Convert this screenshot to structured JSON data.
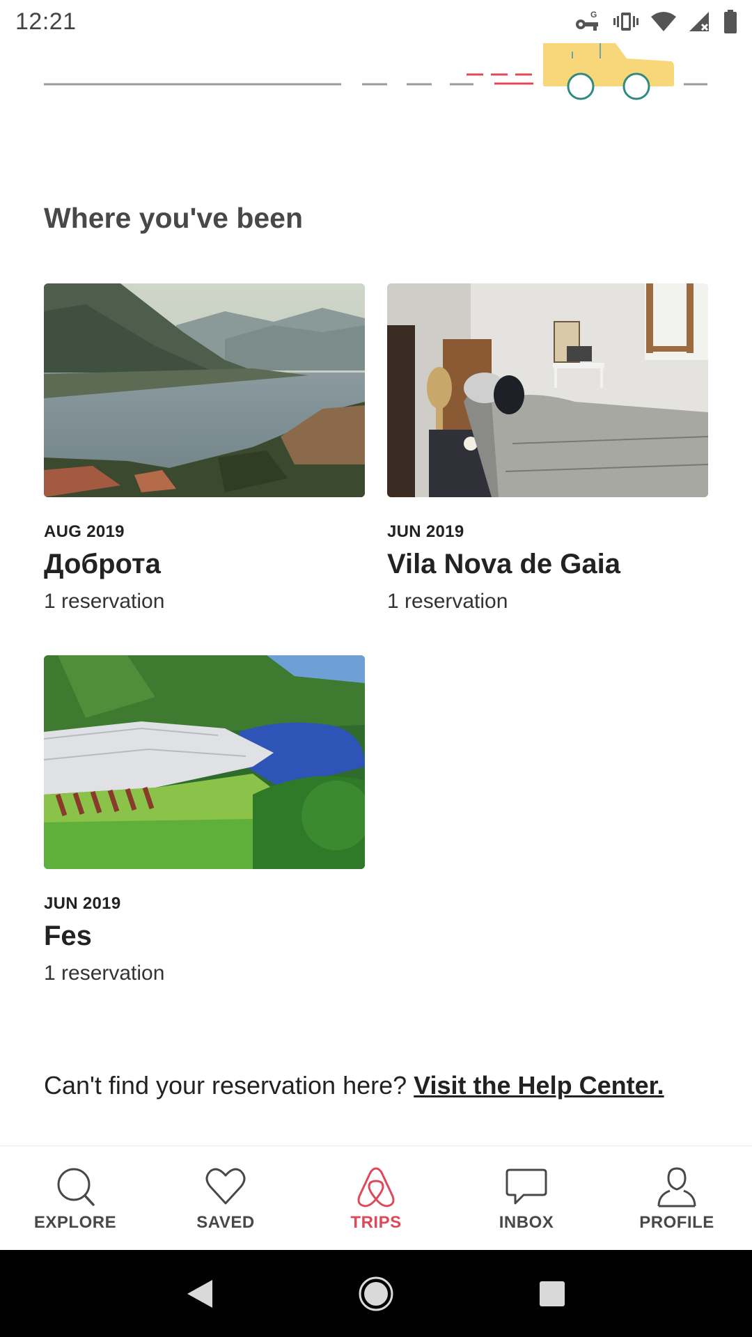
{
  "status_bar": {
    "time": "12:21",
    "icons": [
      "vpn-key-icon",
      "vibrate-icon",
      "wifi-icon",
      "signal-off-icon",
      "battery-icon"
    ]
  },
  "section": {
    "title": "Where you've been"
  },
  "trips": [
    {
      "date": "AUG 2019",
      "title": "Доброта",
      "subtitle": "1 reservation",
      "photo": "lake-mountains"
    },
    {
      "date": "JUN 2019",
      "title": "Vila Nova de Gaia",
      "subtitle": "1 reservation",
      "photo": "bedroom"
    },
    {
      "date": "JUN 2019",
      "title": "Fes",
      "subtitle": "1 reservation",
      "photo": "garden-lake"
    }
  ],
  "help": {
    "question": "Can't find your reservation here? ",
    "link": "Visit the Help Center."
  },
  "bottom_nav": {
    "items": [
      {
        "label": "EXPLORE",
        "icon": "search-icon",
        "active": false
      },
      {
        "label": "SAVED",
        "icon": "heart-icon",
        "active": false
      },
      {
        "label": "TRIPS",
        "icon": "airbnb-logo-icon",
        "active": true
      },
      {
        "label": "INBOX",
        "icon": "chat-bubble-icon",
        "active": false
      },
      {
        "label": "PROFILE",
        "icon": "user-icon",
        "active": false
      }
    ]
  },
  "colors": {
    "accent": "#e0485a",
    "text": "#222222",
    "muted": "#484848",
    "car": "#f8d77a"
  }
}
